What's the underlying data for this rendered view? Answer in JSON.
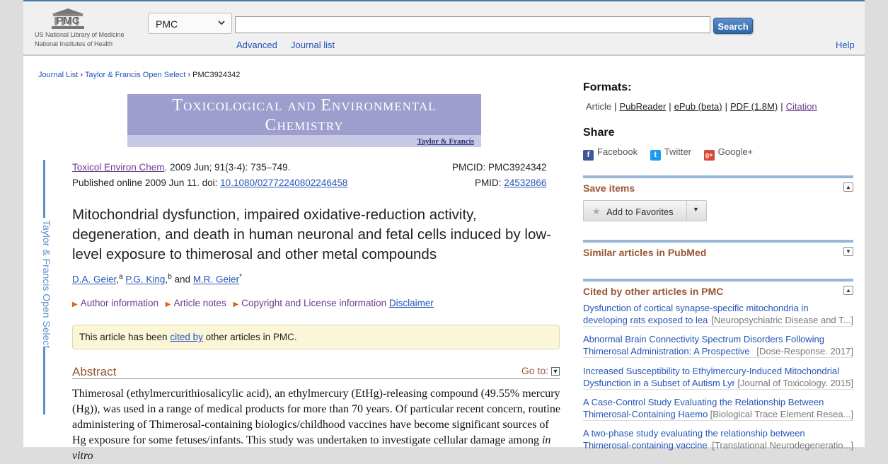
{
  "header": {
    "logo_text": "PMC",
    "logo_line1": "US National Library of Medicine",
    "logo_line2": "National Institutes of Health",
    "db_select_value": "PMC",
    "search_value": "",
    "search_button": "Search",
    "advanced": "Advanced",
    "journal_list": "Journal list",
    "help": "Help"
  },
  "breadcrumb": {
    "item1": "Journal List",
    "sep1": "›",
    "item2": "Taylor & Francis Open Select",
    "sep2": "›",
    "item3": "PMC3924342"
  },
  "banner": {
    "title_line1": "Toxicological and Environmental",
    "title_line2": "Chemistry",
    "publisher": "Taylor & Francis"
  },
  "side_tab": "Taylor & Francis Open Select",
  "citation": {
    "journal": "Toxicol Environ Chem",
    "details": ". 2009 Jun; 91(3-4): 735–749.",
    "published": "Published online 2009 Jun 11. doi: ",
    "doi": "10.1080/02772240802246458",
    "pmcid": "PMCID: PMC3924342",
    "pmid_label": "PMID: ",
    "pmid": "24532866"
  },
  "article": {
    "title": "Mitochondrial dysfunction, impaired oxidative-reduction activity, degeneration, and death in human neuronal and fetal cells induced by low-level exposure to thimerosal and other metal compounds",
    "author1": "D.A. Geier",
    "author1_sup": "a",
    "author2": "P.G. King",
    "author2_sup": "b",
    "and": "and",
    "author3": "M.R. Geier",
    "author3_sup": "*",
    "author_info": "Author information",
    "article_notes": "Article notes",
    "copyright": "Copyright and License information",
    "disclaimer": "Disclaimer",
    "cited_pre": "This article has been ",
    "cited_link": "cited by",
    "cited_post": " other articles in PMC.",
    "abstract_heading": "Abstract",
    "goto": "Go to:",
    "abstract_text_a": "Thimerosal (ethylmercurithiosalicylic acid), an ethylmercury (EtHg)-releasing compound (49.55% mercury (Hg)), was used in a range of medical products for more than 70 years. Of particular recent concern, routine administering of Thimerosal-containing biologics/childhood vaccines have become significant sources of Hg exposure for some fetuses/infants. This study was undertaken to investigate cellular damage among ",
    "abstract_text_em": "in vitro"
  },
  "right": {
    "formats_heading": "Formats:",
    "format_article": "Article",
    "format_pubreader": "PubReader",
    "format_epub": "ePub (beta)",
    "format_pdf": "PDF (1.8M)",
    "format_citation": "Citation",
    "sep": "|",
    "share_heading": "Share",
    "facebook": "Facebook",
    "twitter": "Twitter",
    "googleplus": "Google+",
    "save_items": "Save items",
    "add_favorites": "Add to Favorites",
    "similar_articles": "Similar articles in PubMed",
    "cited_heading": "Cited by other articles in PMC",
    "cited_items": [
      {
        "line1": "Dysfunction of cortical synapse-specific mitochondria in",
        "line2": "developing rats exposed to lead",
        "source": "[Neuropsychiatric Disease and T...]"
      },
      {
        "line1": "Abnormal Brain Connectivity Spectrum Disorders Following",
        "line2": "Thimerosal Administration: A Prospective",
        "source": "[Dose-Response. 2017]"
      },
      {
        "line1": "Increased Susceptibility to Ethylmercury-Induced Mitochondrial",
        "line2": "Dysfunction in a Subset of Autism Lymphoblastoid",
        "source": "[Journal of Toxicology. 2015]"
      },
      {
        "line1": "A Case-Control Study Evaluating the Relationship Between",
        "line2": "Thimerosal-Containing Haemophilus",
        "source": "[Biological Trace Element Resea...]"
      },
      {
        "line1": "A two-phase study evaluating the relationship between",
        "line2": "Thimerosal-containing vaccine",
        "source": "[Translational Neurodegeneratio...]"
      }
    ]
  },
  "colors": {
    "link": "#2354b8",
    "visited": "#6b3b8b",
    "heading_brown": "#985735",
    "accent_blue": "#5f8fcb"
  }
}
